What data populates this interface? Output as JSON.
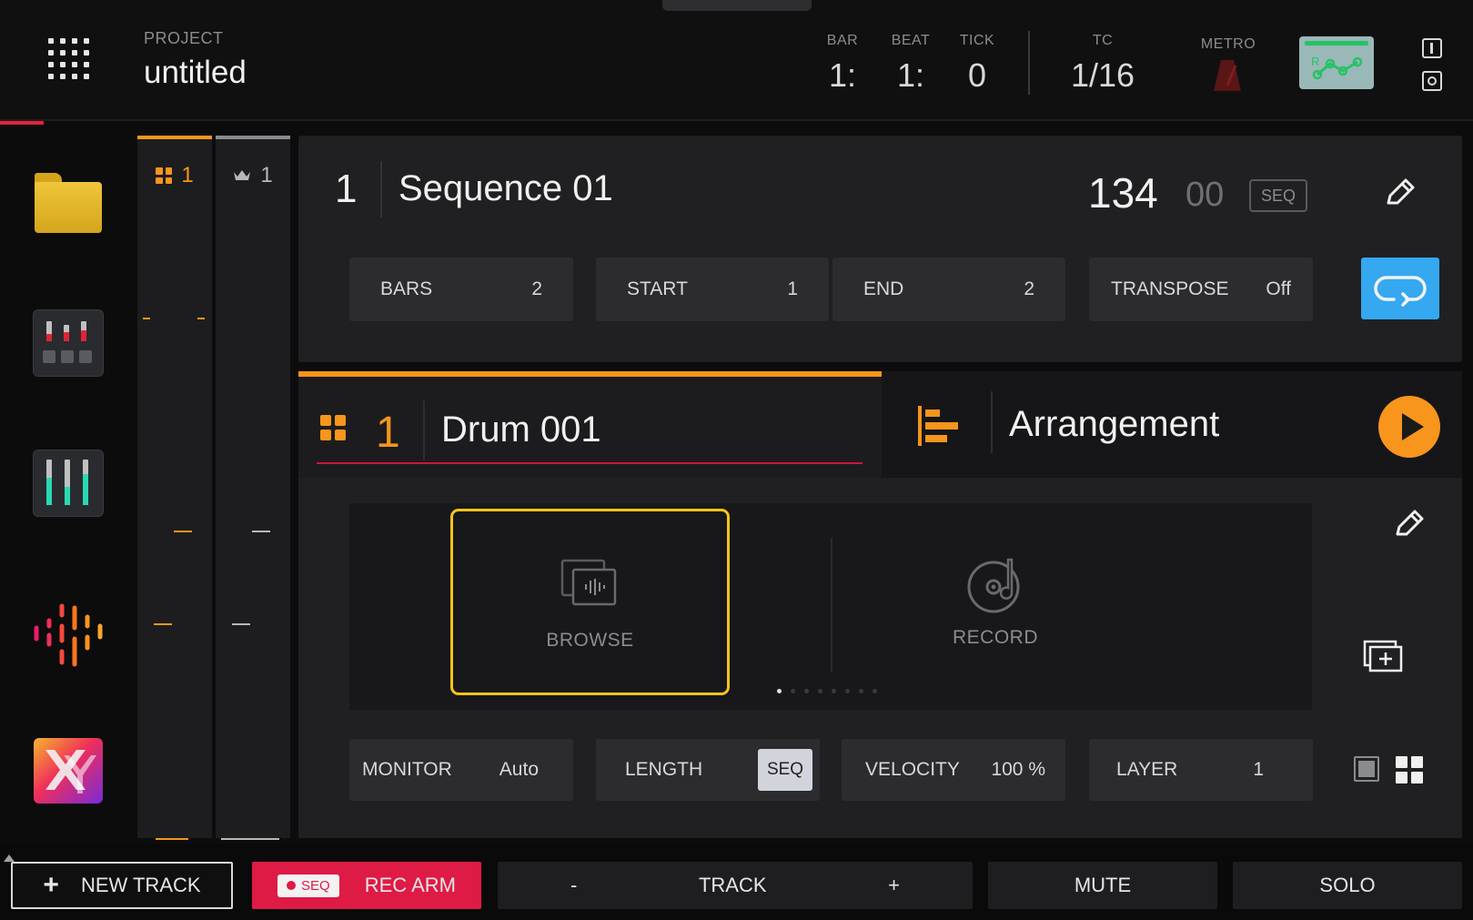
{
  "header": {
    "project_label": "PROJECT",
    "project_name": "untitled",
    "bar_label": "BAR",
    "bar_value": "1:",
    "beat_label": "BEAT",
    "beat_value": "1:",
    "tick_label": "TICK",
    "tick_value": "0",
    "tc_label": "TC",
    "tc_value": "1/16",
    "metro_label": "METRO",
    "automation_letter": "R"
  },
  "strips": [
    {
      "label": "1",
      "icon": "drum-grid-icon"
    },
    {
      "label": "1",
      "icon": "crown-icon"
    }
  ],
  "sequence": {
    "number": "1",
    "name": "Sequence 01",
    "tempo_int": "134",
    "tempo_dec": "00",
    "tempo_mode": "SEQ",
    "params": [
      {
        "label": "BARS",
        "value": "2"
      },
      {
        "label": "START",
        "value": "1"
      },
      {
        "label": "END",
        "value": "2"
      },
      {
        "label": "TRANSPOSE",
        "value": "Off"
      }
    ]
  },
  "track": {
    "number": "1",
    "name": "Drum 001"
  },
  "arrangement": {
    "name": "Arrangement"
  },
  "content": {
    "browse_label": "BROWSE",
    "record_label": "RECORD",
    "page_count": 8,
    "active_page": 1,
    "params": [
      {
        "label": "MONITOR",
        "value": "Auto"
      },
      {
        "label": "LENGTH",
        "value": "SEQ"
      },
      {
        "label": "VELOCITY",
        "value": "100 %"
      },
      {
        "label": "LAYER",
        "value": "1"
      }
    ]
  },
  "bottom": {
    "new_track_label": "NEW TRACK",
    "rec_chip": "SEQ",
    "rec_arm_label": "REC ARM",
    "track_minus": "-",
    "track_label": "TRACK",
    "track_plus": "+",
    "mute_label": "MUTE",
    "solo_label": "SOLO"
  },
  "colors": {
    "accent_orange": "#f7951d",
    "rec_red": "#de1b45",
    "loop_blue": "#35a8f0",
    "selection_yellow": "#f5c518"
  }
}
